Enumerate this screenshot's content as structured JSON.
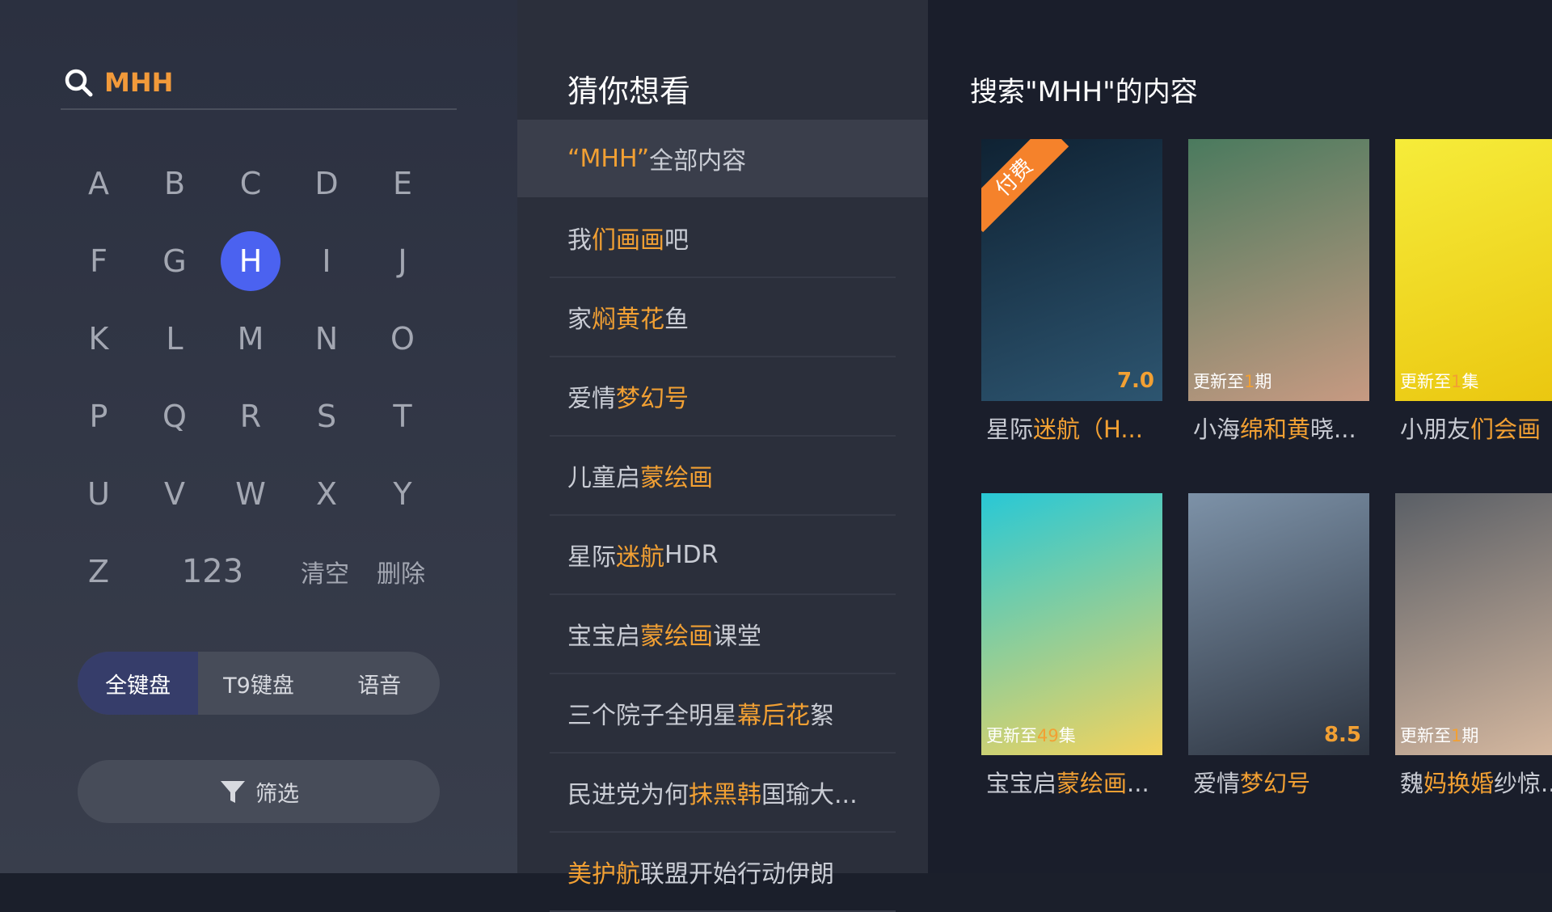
{
  "search": {
    "query": "MHH"
  },
  "keyboard": {
    "rows": [
      [
        "A",
        "B",
        "C",
        "D",
        "E"
      ],
      [
        "F",
        "G",
        "H",
        "I",
        "J"
      ],
      [
        "K",
        "L",
        "M",
        "N",
        "O"
      ],
      [
        "P",
        "Q",
        "R",
        "S",
        "T"
      ],
      [
        "U",
        "V",
        "W",
        "X",
        "Y"
      ]
    ],
    "last_row": {
      "z": "Z",
      "num": "123",
      "clear": "清空",
      "delete": "删除"
    },
    "active_key": "H"
  },
  "modes": {
    "full": "全键盘",
    "t9": "T9键盘",
    "voice": "语音"
  },
  "filter_label": "筛选",
  "suggestions_title": "猜你想看",
  "suggestions": [
    {
      "parts": [
        [
          "“MHH”",
          true
        ],
        [
          "全部内容",
          false
        ]
      ]
    },
    {
      "parts": [
        [
          "我",
          false
        ],
        [
          "们画画",
          true
        ],
        [
          "吧",
          false
        ]
      ]
    },
    {
      "parts": [
        [
          "家",
          false
        ],
        [
          "焖黄花",
          true
        ],
        [
          "鱼",
          false
        ]
      ]
    },
    {
      "parts": [
        [
          "爱情",
          false
        ],
        [
          "梦幻号",
          true
        ]
      ]
    },
    {
      "parts": [
        [
          "儿童启",
          false
        ],
        [
          "蒙绘画",
          true
        ]
      ]
    },
    {
      "parts": [
        [
          "星际",
          false
        ],
        [
          "迷航",
          true
        ],
        [
          "HDR",
          false
        ]
      ]
    },
    {
      "parts": [
        [
          "宝宝启",
          false
        ],
        [
          "蒙绘画",
          true
        ],
        [
          "课堂",
          false
        ]
      ]
    },
    {
      "parts": [
        [
          "三个院子全明星",
          false
        ],
        [
          "幕后花",
          true
        ],
        [
          "絮",
          false
        ]
      ]
    },
    {
      "parts": [
        [
          "民进党为何",
          false
        ],
        [
          "抹黑韩",
          true
        ],
        [
          "国瑜大...",
          false
        ]
      ]
    },
    {
      "parts": [
        [
          "美护航",
          true
        ],
        [
          "联盟开始行动伊朗",
          false
        ]
      ]
    }
  ],
  "results_title": "搜索\"MHH\"的内容",
  "results": [
    {
      "caption": [
        [
          "星际",
          false
        ],
        [
          "迷航（H...",
          true
        ]
      ],
      "score": "7.0",
      "ribbon": "付费",
      "colors": [
        "#0f2233",
        "#2d5570"
      ]
    },
    {
      "caption": [
        [
          "小海",
          false
        ],
        [
          "绵和黄",
          true
        ],
        [
          "晓...",
          false
        ]
      ],
      "update": [
        "更新至",
        "1",
        "期"
      ],
      "colors": [
        "#4a7a5e",
        "#c79a82"
      ]
    },
    {
      "caption": [
        [
          "小朋友",
          false
        ],
        [
          "们会画",
          true
        ]
      ],
      "update": [
        "更新至",
        "1",
        "集"
      ],
      "colors": [
        "#f6ec3a",
        "#eac60f"
      ]
    },
    {
      "caption": [
        [
          "宝宝启",
          false
        ],
        [
          "蒙绘画",
          true
        ],
        [
          "...",
          false
        ]
      ],
      "update": [
        "更新至",
        "49",
        "集"
      ],
      "colors": [
        "#28c8d6",
        "#f3d35d"
      ]
    },
    {
      "caption": [
        [
          "爱情",
          false
        ],
        [
          "梦幻号",
          true
        ]
      ],
      "score": "8.5",
      "colors": [
        "#7d92a8",
        "#2d3440"
      ]
    },
    {
      "caption": [
        [
          "魏",
          false
        ],
        [
          "妈换婚",
          true
        ],
        [
          "纱惊...",
          false
        ]
      ],
      "update": [
        "更新至",
        "1",
        "期"
      ],
      "colors": [
        "#5a5f66",
        "#d7b9a0"
      ]
    }
  ]
}
